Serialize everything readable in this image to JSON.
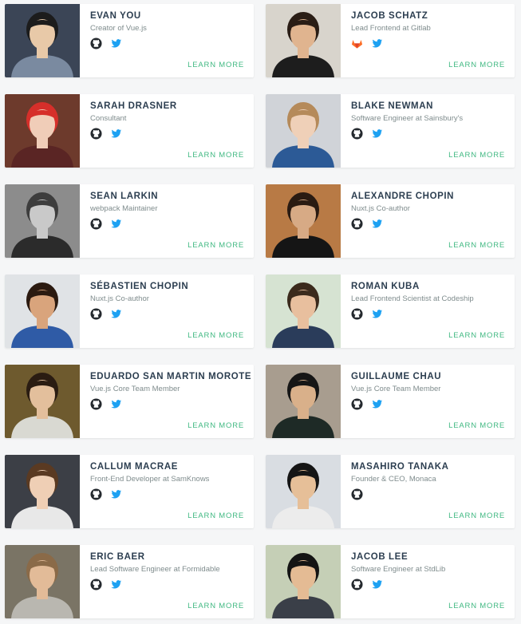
{
  "link_label": "LEARN MORE",
  "colors": {
    "accent": "#42b983",
    "name_text": "#2c3e50",
    "role_text": "#7f8c8d",
    "github": "#24292e",
    "twitter": "#1da1f2",
    "gitlab": "#e24329"
  },
  "members": [
    {
      "name": "EVAN YOU",
      "role": "Creator of Vue.js",
      "icons": [
        "github-icon",
        "twitter-icon"
      ],
      "bg": "#3b4556",
      "skin": "#e8c9a8",
      "hair": "#1c1c1c",
      "shirt": "#7a8aa0"
    },
    {
      "name": "JACOB SCHATZ",
      "role": "Lead Frontend at Gitlab",
      "icons": [
        "gitlab-icon",
        "twitter-icon"
      ],
      "bg": "#d8d4cc",
      "skin": "#e0b48f",
      "hair": "#2a1d15",
      "shirt": "#1d1d1d"
    },
    {
      "name": "SARAH DRASNER",
      "role": "Consultant",
      "icons": [
        "github-icon",
        "twitter-icon"
      ],
      "bg": "#6d3a2c",
      "skin": "#f0cdb8",
      "hair": "#d62f2a",
      "shirt": "#5a2524"
    },
    {
      "name": "BLAKE NEWMAN",
      "role": "Software Engineer at Sainsbury's",
      "icons": [
        "github-icon",
        "twitter-icon"
      ],
      "bg": "#d0d3d8",
      "skin": "#efd0b8",
      "hair": "#b58a5a",
      "shirt": "#2c5a96"
    },
    {
      "name": "SEAN LARKIN",
      "role": "webpack Maintainer",
      "icons": [
        "github-icon",
        "twitter-icon"
      ],
      "bg": "#8c8c8c",
      "skin": "#c9c9c9",
      "hair": "#3d3d3d",
      "shirt": "#2b2b2b"
    },
    {
      "name": "ALEXANDRE CHOPIN",
      "role": "Nuxt.js Co-author",
      "icons": [
        "github-icon",
        "twitter-icon"
      ],
      "bg": "#b87a45",
      "skin": "#d7aa85",
      "hair": "#2a1b12",
      "shirt": "#151515"
    },
    {
      "name": "SÉBASTIEN CHOPIN",
      "role": "Nuxt.js Co-author",
      "icons": [
        "github-icon",
        "twitter-icon"
      ],
      "bg": "#e0e3e6",
      "skin": "#d9a47c",
      "hair": "#2b1a10",
      "shirt": "#2f5ba6"
    },
    {
      "name": "ROMAN KUBA",
      "role": "Lead Frontend Scientist at Codeship",
      "icons": [
        "github-icon",
        "twitter-icon"
      ],
      "bg": "#d6e3d2",
      "skin": "#e8bf9e",
      "hair": "#3b2a1c",
      "shirt": "#2a3c5a"
    },
    {
      "name": "EDUARDO SAN MARTIN MOROTE",
      "role": "Vue.js Core Team Member",
      "icons": [
        "github-icon",
        "twitter-icon"
      ],
      "bg": "#6e5a2e",
      "skin": "#e3bf9c",
      "hair": "#2a1c12",
      "shirt": "#d9d9d2"
    },
    {
      "name": "GUILLAUME CHAU",
      "role": "Vue.js Core Team Member",
      "icons": [
        "github-icon",
        "twitter-icon"
      ],
      "bg": "#a89d8f",
      "skin": "#d9b08a",
      "hair": "#161616",
      "shirt": "#1e2a26"
    },
    {
      "name": "CALLUM MACRAE",
      "role": "Front-End Developer at SamKnows",
      "icons": [
        "github-icon",
        "twitter-icon"
      ],
      "bg": "#3c3f46",
      "skin": "#efcfb5",
      "hair": "#5a3a22",
      "shirt": "#e8e8e8"
    },
    {
      "name": "MASAHIRO TANAKA",
      "role": "Founder & CEO, Monaca",
      "icons": [
        "github-icon"
      ],
      "bg": "#d9dde2",
      "skin": "#e6bf98",
      "hair": "#151515",
      "shirt": "#ececec"
    },
    {
      "name": "ERIC BAER",
      "role": "Lead Software Engineer at Formidable",
      "icons": [
        "github-icon",
        "twitter-icon"
      ],
      "bg": "#7a7465",
      "skin": "#e2bb98",
      "hair": "#8a6a48",
      "shirt": "#b9b7b0"
    },
    {
      "name": "JACOB LEE",
      "role": "Software Engineer at StdLib",
      "icons": [
        "github-icon",
        "twitter-icon"
      ],
      "bg": "#c5cfb6",
      "skin": "#e4bb94",
      "hair": "#141414",
      "shirt": "#3a3f48"
    }
  ]
}
